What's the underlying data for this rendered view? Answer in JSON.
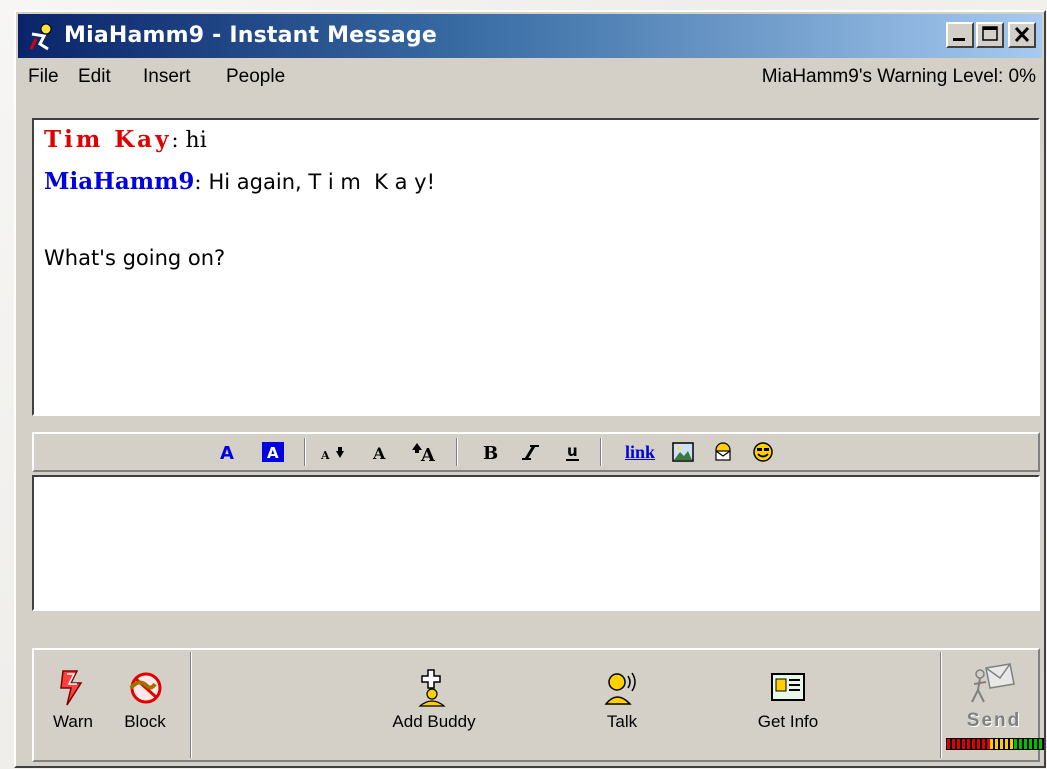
{
  "window": {
    "title": "MiaHamm9 - Instant Message",
    "title_bar_color": "#0a246a"
  },
  "menu": {
    "items": [
      {
        "label": "File",
        "accel": "F"
      },
      {
        "label": "Edit",
        "accel": "E"
      },
      {
        "label": "Insert",
        "accel": "n"
      },
      {
        "label": "People",
        "accel": "P"
      }
    ],
    "warning_level": "MiaHamm9's Warning Level: 0%"
  },
  "conversation": [
    {
      "screen_name": "Tim Kay",
      "color": "#e00000",
      "separator": ":",
      "message_lines": [
        "hi"
      ]
    },
    {
      "screen_name": "MiaHamm9",
      "color": "#0000e0",
      "separator": ":",
      "message_lines": [
        "Hi again, T i m  K a y!",
        "",
        "What's going on?"
      ]
    }
  ],
  "format_toolbar": {
    "buttons": [
      {
        "icon": "text-color-icon"
      },
      {
        "icon": "background-color-icon"
      },
      {
        "icon": "decrease-font-size-icon"
      },
      {
        "icon": "normal-font-size-icon"
      },
      {
        "icon": "increase-font-size-icon"
      },
      {
        "icon": "bold-icon"
      },
      {
        "icon": "italic-icon"
      },
      {
        "icon": "underline-icon"
      },
      {
        "icon": "link-icon",
        "label": "link"
      },
      {
        "icon": "insert-picture-icon"
      },
      {
        "icon": "send-mail-icon"
      },
      {
        "icon": "smiley-icon"
      }
    ],
    "accent_blue": "#0000e0"
  },
  "compose": {
    "value": ""
  },
  "bottom_toolbar": {
    "warn": {
      "label": "Warn",
      "icon": "warn-lightning-icon"
    },
    "block": {
      "label": "Block",
      "icon": "block-icon"
    },
    "add_buddy": {
      "label": "Add Buddy",
      "icon": "add-buddy-icon"
    },
    "talk": {
      "label": "Talk",
      "icon": "talk-icon"
    },
    "get_info": {
      "label": "Get Info",
      "icon": "get-info-icon"
    },
    "send": {
      "label": "Send",
      "icon": "send-icon",
      "enabled": false
    }
  }
}
